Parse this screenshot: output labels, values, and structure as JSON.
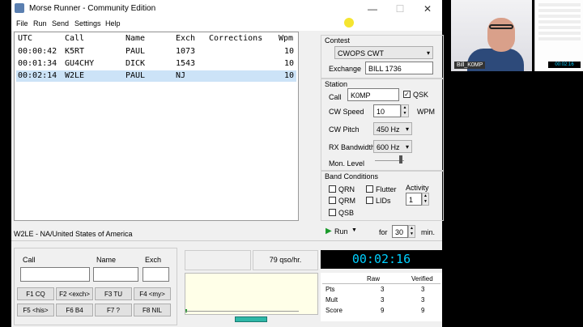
{
  "window": {
    "title": "Morse Runner - Community Edition",
    "controls": [
      "—",
      "☐",
      "✕"
    ]
  },
  "menu": [
    "File",
    "Run",
    "Send",
    "Settings",
    "Help"
  ],
  "log": {
    "columns": [
      "UTC",
      "Call",
      "Name",
      "Exch",
      "Corrections",
      "Wpm"
    ],
    "rows": [
      {
        "utc": "00:00:42",
        "call": "K5RT",
        "name": "PAUL",
        "exch": "1073",
        "corr": "",
        "wpm": "10"
      },
      {
        "utc": "00:01:34",
        "call": "GU4CHY",
        "name": "DICK",
        "exch": "1543",
        "corr": "",
        "wpm": "10"
      },
      {
        "utc": "00:02:14",
        "call": "W2LE",
        "name": "PAUL",
        "exch": "NJ",
        "corr": "",
        "wpm": "10"
      }
    ]
  },
  "status_text": "W2LE - NA/United States of America",
  "entry": {
    "call_label": "Call",
    "name_label": "Name",
    "exch_label": "Exch",
    "buttons": [
      "F1  CQ",
      "F2  <exch>",
      "F3  TU",
      "F4  <my>",
      "F5  <his>",
      "F6  B4",
      "F7  ?",
      "F8  NIL"
    ]
  },
  "rate": "79  qso/hr.",
  "contest": {
    "group_label": "Contest",
    "value": "CWOPS CWT",
    "exchange_label": "Exchange",
    "exchange_value": "BILL 1736"
  },
  "station": {
    "group_label": "Station",
    "call_label": "Call",
    "call_value": "K0MP",
    "qsk_label": "QSK",
    "cw_speed_label": "CW Speed",
    "cw_speed_value": "10",
    "wpm_label": "WPM",
    "cw_pitch_label": "CW Pitch",
    "cw_pitch_value": "450 Hz",
    "rx_bw_label": "RX Bandwidth",
    "rx_bw_value": "600 Hz",
    "mon_level_label": "Mon. Level"
  },
  "band": {
    "group_label": "Band Conditions",
    "qrn": "QRN",
    "qrm": "QRM",
    "qsb": "QSB",
    "flutter": "Flutter",
    "lids": "LIDs",
    "activity_label": "Activity",
    "activity_value": "1"
  },
  "run": {
    "label": "Run",
    "for_label": "for",
    "minutes": "30",
    "min_label": "min."
  },
  "clock": "00:02:16",
  "score": {
    "raw_label": "Raw",
    "verified_label": "Verified",
    "rows": [
      {
        "label": "Pts",
        "raw": "3",
        "verified": "3"
      },
      {
        "label": "Mult",
        "raw": "3",
        "verified": "3"
      },
      {
        "label": "Score",
        "raw": "9",
        "verified": "9"
      }
    ]
  },
  "webcam": {
    "name_tag": "Bill_K0MP"
  },
  "thumb": {
    "clock": "00:02:16"
  },
  "colors": {
    "selected_row": "#cce3f7",
    "clock_text": "#00d0ff",
    "run_arrow": "#1a9a2a"
  }
}
